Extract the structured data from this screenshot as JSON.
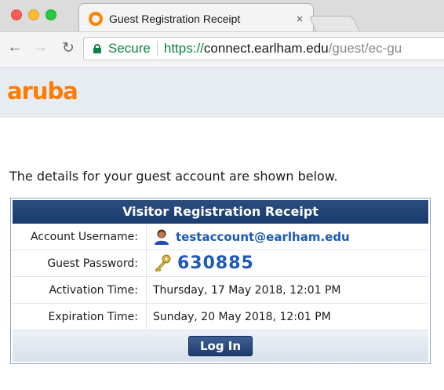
{
  "browser": {
    "tab_title": "Guest Registration Receipt",
    "tab_close": "×",
    "secure_label": "Secure",
    "url_scheme": "https://",
    "url_host": "connect.earlham.edu",
    "url_path": "/guest/ec-gu",
    "colors": {
      "secure": "#0b8043",
      "favicon": "#ff8300"
    }
  },
  "page": {
    "logo_text": "aruba",
    "intro_text": "The details for your guest account are shown below.",
    "receipt": {
      "title": "Visitor Registration Receipt",
      "rows": [
        {
          "label": "Account Username:",
          "value": "testaccount@earlham.edu",
          "icon": "user-icon"
        },
        {
          "label": "Guest Password:",
          "value": "630885",
          "icon": "key-icon"
        },
        {
          "label": "Activation Time:",
          "value": "Thursday, 17 May 2018, 12:01 PM"
        },
        {
          "label": "Expiration Time:",
          "value": "Sunday, 20 May 2018, 12:01 PM"
        }
      ],
      "login_label": "Log In"
    },
    "colors": {
      "brand": "#ff7a00",
      "header_bg": "#193a6c",
      "link": "#1d5ab7"
    }
  }
}
